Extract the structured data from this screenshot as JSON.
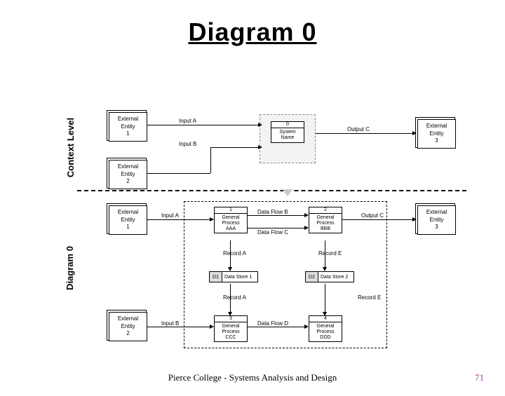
{
  "title": "Diagram 0",
  "sideLabels": {
    "context": "Context Level",
    "diagram0": "Diagram 0"
  },
  "contextLevel": {
    "entity1": "External\nEntity\n1",
    "entity2": "External\nEntity\n2",
    "entity3": "External\nEntity\n3",
    "inputA": "Input A",
    "inputB": "Input B",
    "outputC": "Output C",
    "proc0": {
      "num": "0",
      "name": "System\nName"
    }
  },
  "diagram0": {
    "entity1": "External\nEntity\n1",
    "entity2": "External\nEntity\n2",
    "entity3": "External\nEntity\n3",
    "inputA": "Input A",
    "inputB": "Input B",
    "outputC": "Output C",
    "flowB": "Data Flow B",
    "flowC": "Data Flow C",
    "flowD": "Data Flow D",
    "recordA1": "Record A",
    "recordA2": "Record A",
    "recordE1": "Record E",
    "recordE2": "Record E",
    "proc1": {
      "num": "1",
      "name": "General\nProcess\nAAA"
    },
    "proc2": {
      "num": "2",
      "name": "General\nProcess\nBBB"
    },
    "proc3": {
      "num": "3",
      "name": "General\nProcess\nCCC"
    },
    "proc4": {
      "num": "4",
      "name": "General\nProcess\nDDD"
    },
    "ds1": {
      "id": "D1",
      "name": "Data Store 1"
    },
    "ds2": {
      "id": "D2",
      "name": "Data Store 2"
    }
  },
  "footer": "Pierce College - Systems Analysis and Design",
  "pageNum": "71"
}
